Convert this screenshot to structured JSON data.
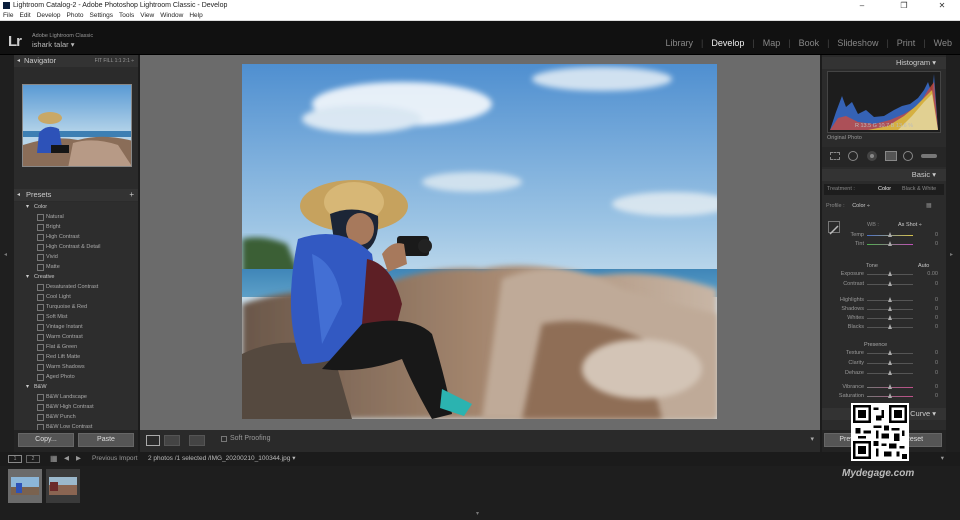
{
  "window": {
    "title": "Lightroom Catalog-2 - Adobe Photoshop Lightroom Classic - Develop",
    "controls": [
      "–",
      "❐",
      "✕"
    ]
  },
  "menu": [
    "File",
    "Edit",
    "Develop",
    "Photo",
    "Settings",
    "Tools",
    "View",
    "Window",
    "Help"
  ],
  "header": {
    "logo": "Lr",
    "app_name": "Adobe Lightroom Classic",
    "user": "ishark talar  ▾",
    "modules": [
      "Library",
      "Develop",
      "Map",
      "Book",
      "Slideshow",
      "Print",
      "Web"
    ],
    "active_module": "Develop"
  },
  "left": {
    "navigator_label": "Navigator",
    "zoom_options": "FIT   FILL   1:1   2:1 ÷",
    "presets_label": "Presets",
    "presets_add": "+",
    "presets": [
      {
        "type": "group",
        "label": "Color"
      },
      {
        "type": "leaf",
        "label": "Natural"
      },
      {
        "type": "leaf",
        "label": "Bright"
      },
      {
        "type": "leaf",
        "label": "High Contrast"
      },
      {
        "type": "leaf",
        "label": "High Contrast & Detail"
      },
      {
        "type": "leaf",
        "label": "Vivid"
      },
      {
        "type": "leaf",
        "label": "Matte"
      },
      {
        "type": "group",
        "label": "Creative"
      },
      {
        "type": "leaf",
        "label": "Desaturated Contrast"
      },
      {
        "type": "leaf",
        "label": "Cool Light"
      },
      {
        "type": "leaf",
        "label": "Turquoise & Red"
      },
      {
        "type": "leaf",
        "label": "Soft Mist"
      },
      {
        "type": "leaf",
        "label": "Vintage Instant"
      },
      {
        "type": "leaf",
        "label": "Warm Contrast"
      },
      {
        "type": "leaf",
        "label": "Flat & Green"
      },
      {
        "type": "leaf",
        "label": "Red Lift Matte"
      },
      {
        "type": "leaf",
        "label": "Warm Shadows"
      },
      {
        "type": "leaf",
        "label": "Aged Photo"
      },
      {
        "type": "group",
        "label": "B&W"
      },
      {
        "type": "leaf",
        "label": "B&W Landscape"
      },
      {
        "type": "leaf",
        "label": "B&W High Contrast"
      },
      {
        "type": "leaf",
        "label": "B&W Punch"
      },
      {
        "type": "leaf",
        "label": "B&W Low Contrast"
      }
    ],
    "copy_button": "Copy...",
    "paste_button": "Paste"
  },
  "toolbar": {
    "soft_proofing": "Soft Proofing"
  },
  "right": {
    "histogram_label": "Histogram ▾",
    "rgb_readout": "R  13.5   G  10.7   B  13.6  %",
    "original_photo": "Original Photo",
    "basic_label": "Basic ▾",
    "treatment_label": "Treatment :",
    "treatment_color": "Color",
    "treatment_bw": "Black & White",
    "profile_label": "Profile :",
    "profile_value": "Color ÷",
    "wb_label": "WB :",
    "wb_value": "As Shot ÷",
    "tone_label": "Tone",
    "auto_label": "Auto",
    "presence_label": "Presence",
    "curve_label": "Tone Curve ▾",
    "prev_button": "Previous",
    "reset_button": "Reset",
    "sliders": [
      {
        "label": "Temp",
        "value": "0",
        "pos": 0.5
      },
      {
        "label": "Tint",
        "value": "0",
        "pos": 0.5
      },
      {
        "label": "Exposure",
        "value": "0.00",
        "pos": 0.5
      },
      {
        "label": "Contrast",
        "value": "0",
        "pos": 0.5
      },
      {
        "label": "Highlights",
        "value": "0",
        "pos": 0.5
      },
      {
        "label": "Shadows",
        "value": "0",
        "pos": 0.5
      },
      {
        "label": "Whites",
        "value": "0",
        "pos": 0.5
      },
      {
        "label": "Blacks",
        "value": "0",
        "pos": 0.5
      },
      {
        "label": "Texture",
        "value": "0",
        "pos": 0.5
      },
      {
        "label": "Clarity",
        "value": "0",
        "pos": 0.5
      },
      {
        "label": "Dehaze",
        "value": "0",
        "pos": 0.5
      },
      {
        "label": "Vibrance",
        "value": "0",
        "pos": 0.5
      },
      {
        "label": "Saturation",
        "value": "0",
        "pos": 0.5
      }
    ]
  },
  "filmbar": {
    "page1": "1",
    "page2": "2",
    "source": "Previous Import",
    "info": "2 photos /1 selected /IMG_20200210_100344.jpg ▾"
  },
  "watermark": "Mydegage.com"
}
